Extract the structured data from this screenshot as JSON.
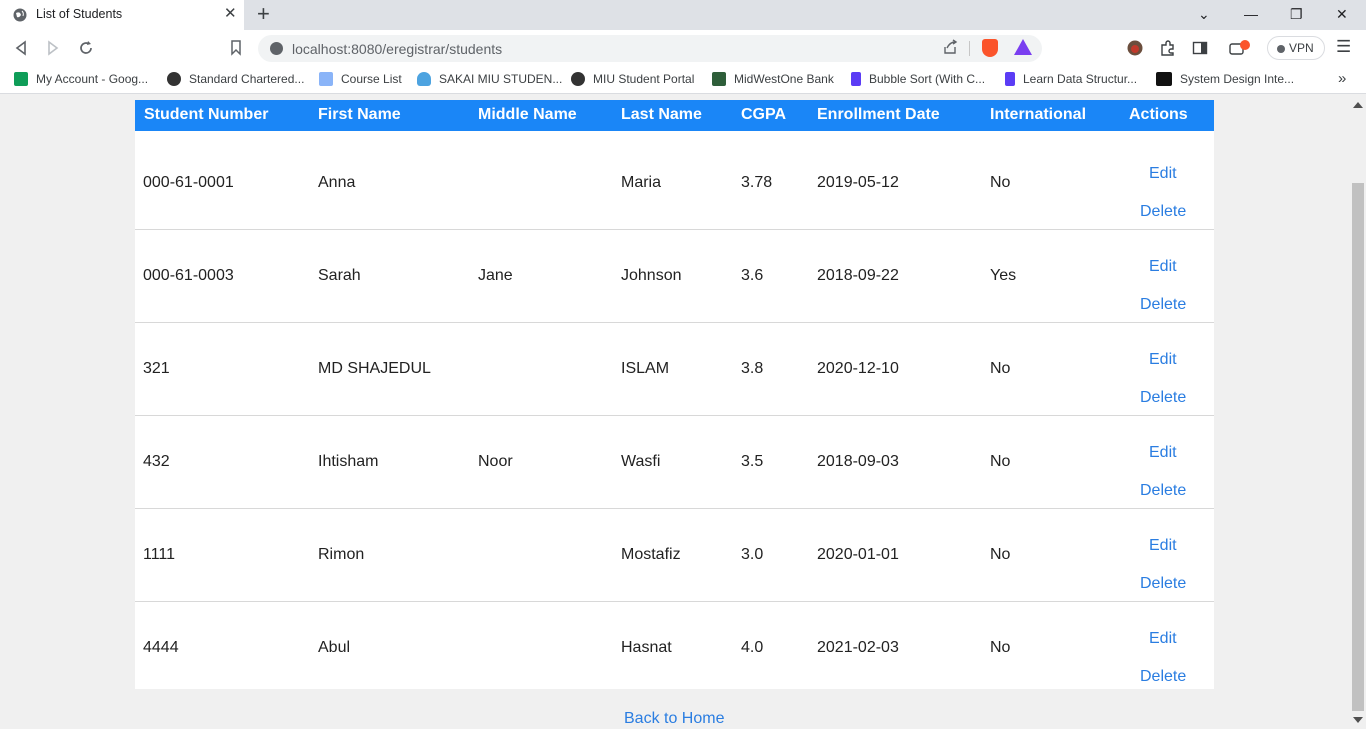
{
  "browser": {
    "tab_title": "List of Students",
    "tab_close": "✕",
    "new_tab": "+",
    "url": "localhost:8080/eregistrar/students",
    "vpn_label": "VPN",
    "window_controls": {
      "dropdown": "⌄",
      "minimize": "—",
      "restore": "❐",
      "close": "✕"
    }
  },
  "bookmarks": [
    {
      "label": "My Account - Goog...",
      "icon": "google-sheets-icon",
      "color": "#0f9d58"
    },
    {
      "label": "Standard Chartered...",
      "icon": "globe-icon",
      "color": "#333333"
    },
    {
      "label": "Course List",
      "icon": "page-icon",
      "color": "#8ab4f8"
    },
    {
      "label": "SAKAI MIU STUDEN...",
      "icon": "sakai-icon",
      "color": "#4da3e0"
    },
    {
      "label": "MIU Student Portal",
      "icon": "globe-icon",
      "color": "#333333"
    },
    {
      "label": "MidWestOne Bank",
      "icon": "bank-icon",
      "color": "#2e5e3a"
    },
    {
      "label": "Bubble Sort (With C...",
      "icon": "programiz-icon",
      "color": "#5b3cf5"
    },
    {
      "label": "Learn Data Structur...",
      "icon": "programiz-icon",
      "color": "#5b3cf5"
    },
    {
      "label": "System Design Inte...",
      "icon": "medium-icon",
      "color": "#111111"
    }
  ],
  "bookmarks_more": "»",
  "table": {
    "headers": [
      "Student Number",
      "First Name",
      "Middle Name",
      "Last Name",
      "CGPA",
      "Enrollment Date",
      "International",
      "Actions"
    ],
    "rows": [
      {
        "student_number": "000-61-0001",
        "first_name": "Anna",
        "middle_name": "",
        "last_name": "Maria",
        "cgpa": "3.78",
        "enrollment_date": "2019-05-12",
        "international": "No"
      },
      {
        "student_number": "000-61-0003",
        "first_name": "Sarah",
        "middle_name": "Jane",
        "last_name": "Johnson",
        "cgpa": "3.6",
        "enrollment_date": "2018-09-22",
        "international": "Yes"
      },
      {
        "student_number": "321",
        "first_name": "MD SHAJEDUL",
        "middle_name": "",
        "last_name": "ISLAM",
        "cgpa": "3.8",
        "enrollment_date": "2020-12-10",
        "international": "No"
      },
      {
        "student_number": "432",
        "first_name": "Ihtisham",
        "middle_name": "Noor",
        "last_name": "Wasfi",
        "cgpa": "3.5",
        "enrollment_date": "2018-09-03",
        "international": "No"
      },
      {
        "student_number": "1111",
        "first_name": "Rimon",
        "middle_name": "",
        "last_name": "Mostafiz",
        "cgpa": "3.0",
        "enrollment_date": "2020-01-01",
        "international": "No"
      },
      {
        "student_number": "4444",
        "first_name": "Abul",
        "middle_name": "",
        "last_name": "Hasnat",
        "cgpa": "4.0",
        "enrollment_date": "2021-02-03",
        "international": "No"
      }
    ],
    "edit_label": "Edit",
    "delete_label": "Delete"
  },
  "back_link": "Back to Home",
  "colors": {
    "header_bg": "#1a86f7",
    "link": "#2a7de1"
  }
}
